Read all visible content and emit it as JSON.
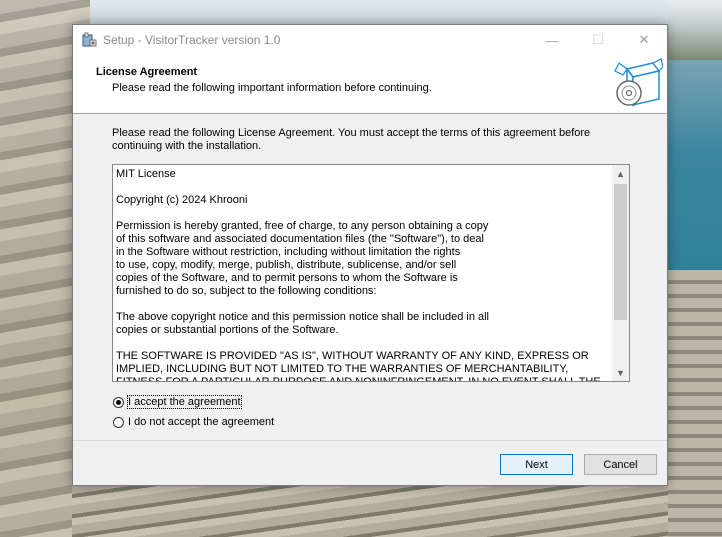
{
  "window": {
    "title": "Setup - VisitorTracker version 1.0",
    "controls": {
      "minimize": "—",
      "maximize": "☐",
      "close": "✕"
    }
  },
  "header": {
    "title": "License Agreement",
    "subtitle": "Please read the following important information before continuing."
  },
  "body": {
    "intro": "Please read the following License Agreement. You must accept the terms of this agreement before continuing with the installation.",
    "license_text": "MIT License\n\nCopyright (c) 2024 Khrooni\n\nPermission is hereby granted, free of charge, to any person obtaining a copy\nof this software and associated documentation files (the \"Software\"), to deal\nin the Software without restriction, including without limitation the rights\nto use, copy, modify, merge, publish, distribute, sublicense, and/or sell\ncopies of the Software, and to permit persons to whom the Software is\nfurnished to do so, subject to the following conditions:\n\nThe above copyright notice and this permission notice shall be included in all\ncopies or substantial portions of the Software.\n\nTHE SOFTWARE IS PROVIDED \"AS IS\", WITHOUT WARRANTY OF ANY KIND, EXPRESS OR\nIMPLIED, INCLUDING BUT NOT LIMITED TO THE WARRANTIES OF MERCHANTABILITY,\nFITNESS FOR A PARTICULAR PURPOSE AND NONINFRINGEMENT. IN NO EVENT SHALL THE",
    "scroll_up": "▲",
    "scroll_down": "▼",
    "options": [
      {
        "label": "I accept the agreement",
        "selected": true
      },
      {
        "label": "I do not accept the agreement",
        "selected": false
      }
    ]
  },
  "footer": {
    "next_label": "Next",
    "cancel_label": "Cancel"
  },
  "icons": {
    "title_icon": "installer-icon",
    "wizard_icon": "setup-box-disc-icon"
  },
  "colors": {
    "default_button_border": "#0078d7",
    "window_bg": "#f0f0f0",
    "header_bg": "#ffffff"
  }
}
